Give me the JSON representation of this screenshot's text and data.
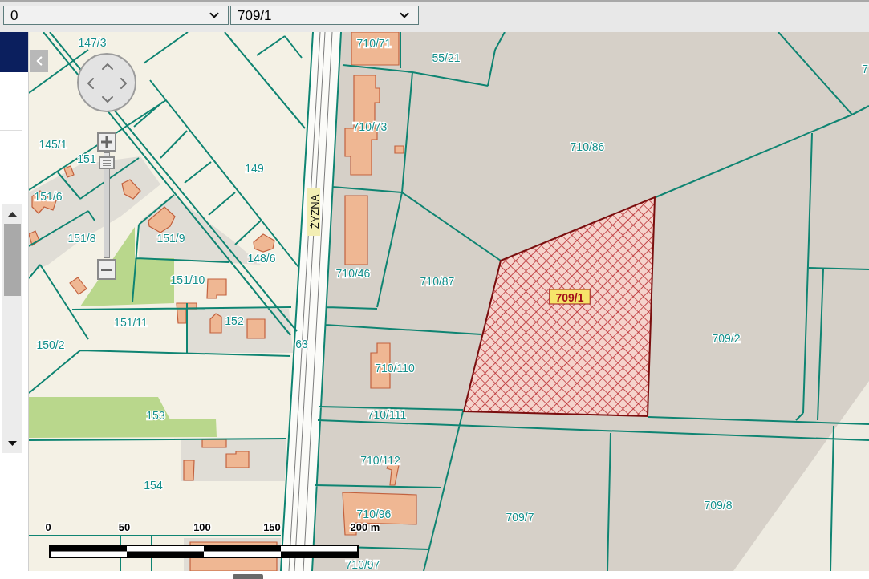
{
  "toolbar": {
    "selects": [
      {
        "value": "0"
      },
      {
        "value": "709/1"
      }
    ]
  },
  "map": {
    "street_label": "ŻYZNA",
    "parcels": [
      {
        "label": "147/3",
        "selected": false
      },
      {
        "label": "710/71",
        "selected": false
      },
      {
        "label": "55/21",
        "selected": false
      },
      {
        "label": "7",
        "selected": false
      },
      {
        "label": "710/73",
        "selected": false
      },
      {
        "label": "145/1",
        "selected": false
      },
      {
        "label": "710/86",
        "selected": false
      },
      {
        "label": "151",
        "selected": false
      },
      {
        "label": "149",
        "selected": false
      },
      {
        "label": "151/6",
        "selected": false
      },
      {
        "label": "151/8",
        "selected": false
      },
      {
        "label": "151/9",
        "selected": false
      },
      {
        "label": "148/6",
        "selected": false
      },
      {
        "label": "710/46",
        "selected": false
      },
      {
        "label": "151/10",
        "selected": false
      },
      {
        "label": "710/87",
        "selected": false
      },
      {
        "label": "709/1",
        "selected": true
      },
      {
        "label": "152",
        "selected": false
      },
      {
        "label": "151/11",
        "selected": false
      },
      {
        "label": "709/2",
        "selected": false
      },
      {
        "label": "63",
        "selected": false
      },
      {
        "label": "150/2",
        "selected": false
      },
      {
        "label": "710/110",
        "selected": false
      },
      {
        "label": "710/111",
        "selected": false
      },
      {
        "label": "153",
        "selected": false
      },
      {
        "label": "710/112",
        "selected": false
      },
      {
        "label": "154",
        "selected": false
      },
      {
        "label": "709/8",
        "selected": false
      },
      {
        "label": "710/96",
        "selected": false
      },
      {
        "label": "709/7",
        "selected": false
      },
      {
        "label": "710/97",
        "selected": false
      }
    ],
    "zoom": {
      "level": 0.9
    },
    "scale_bar": {
      "labels": [
        "0",
        "50",
        "100",
        "150",
        "200 m"
      ]
    }
  }
}
